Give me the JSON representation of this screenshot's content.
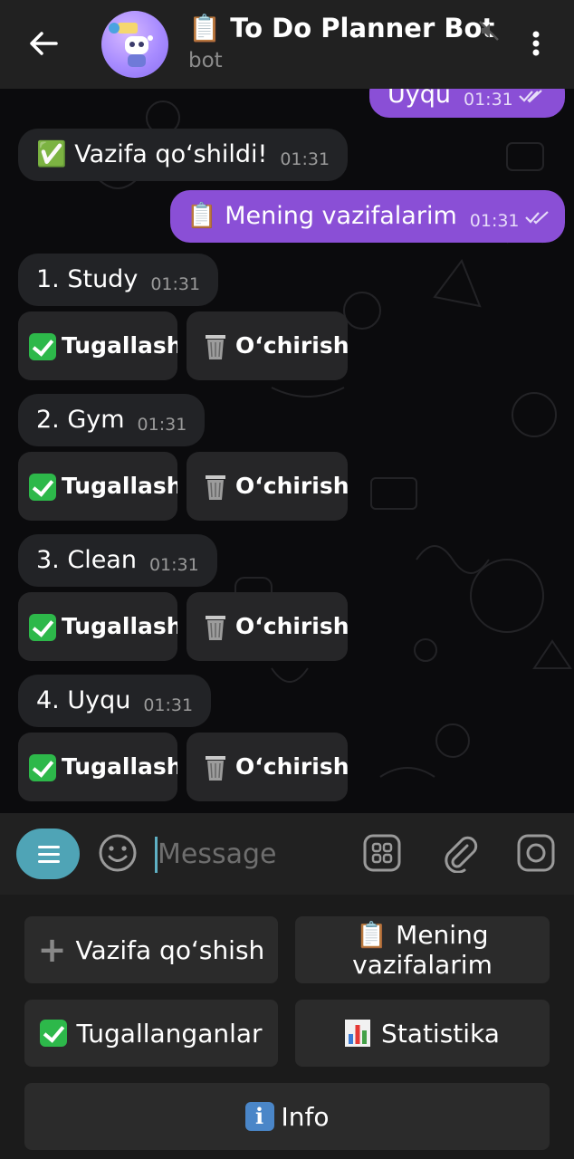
{
  "header": {
    "title": "📋 To Do Planner Bot",
    "subtitle": "bot"
  },
  "messages": [
    {
      "text": "Uyqu",
      "time": "01:31",
      "direction": "out"
    },
    {
      "text": "✅ Vazifa qoʻshildi!",
      "time": "01:31",
      "direction": "in"
    },
    {
      "text": "📋 Mening vazifalarim",
      "time": "01:31",
      "direction": "out"
    },
    {
      "text": "1. Study",
      "time": "01:31",
      "direction": "in"
    },
    {
      "text": "2. Gym",
      "time": "01:31",
      "direction": "in"
    },
    {
      "text": "3. Clean",
      "time": "01:31",
      "direction": "in"
    },
    {
      "text": "4. Uyqu",
      "time": "01:31",
      "direction": "in"
    }
  ],
  "inline_buttons": {
    "complete": "Tugallash",
    "delete": "Oʻchirish"
  },
  "input": {
    "placeholder": "Message"
  },
  "keyboard": {
    "add_task": "Vazifa qoʻshish",
    "my_tasks_line1": "📋 Mening",
    "my_tasks_line2": "vazifalarim",
    "completed": "Tugallanganlar",
    "stats": "Statistika",
    "info": "Info"
  },
  "colors": {
    "outgoing_bubble": "#8a4fd6",
    "incoming_bubble": "#222326",
    "accent": "#4fa4b6"
  }
}
